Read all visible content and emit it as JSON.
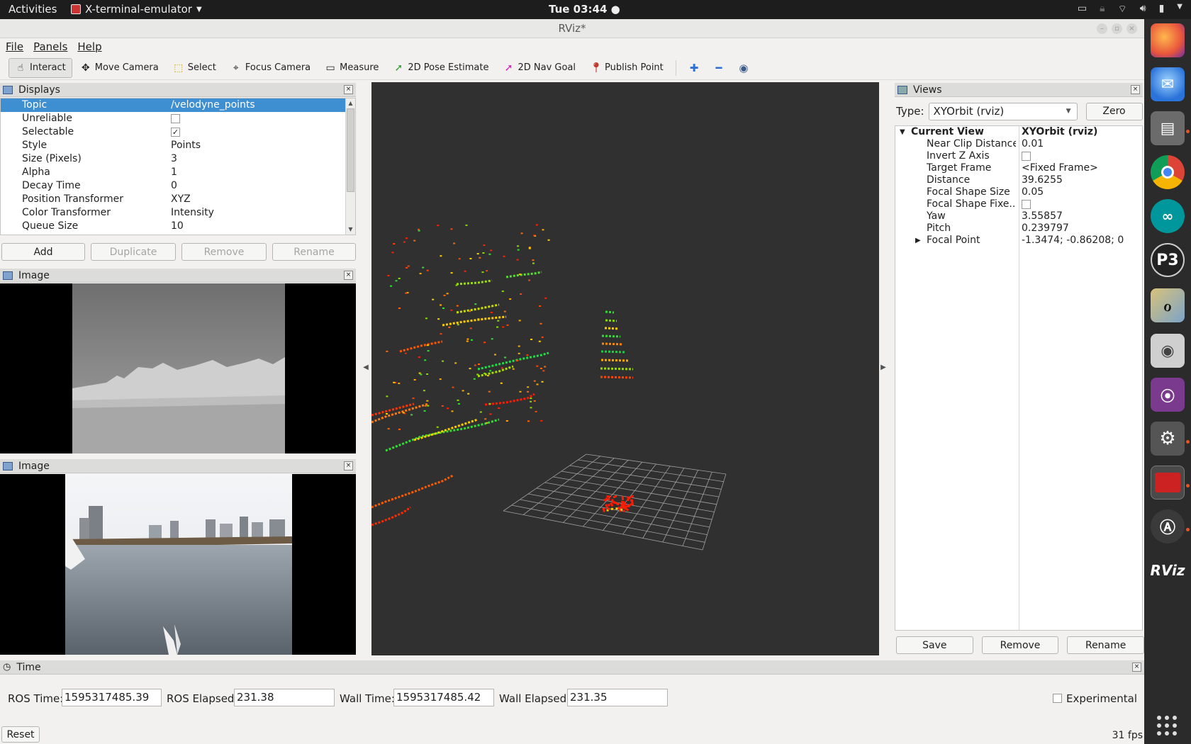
{
  "topbar": {
    "activities": "Activities",
    "app_name": "X-terminal-emulator",
    "clock": "Tue 03:44"
  },
  "window": {
    "title": "RViz*"
  },
  "menu": {
    "file": "File",
    "panels": "Panels",
    "help": "Help"
  },
  "toolbar": {
    "interact": "Interact",
    "move_camera": "Move Camera",
    "select": "Select",
    "focus_camera": "Focus Camera",
    "measure": "Measure",
    "pose_estimate": "2D Pose Estimate",
    "nav_goal": "2D Nav Goal",
    "publish_point": "Publish Point"
  },
  "displays": {
    "title": "Displays",
    "props": [
      {
        "key": "Topic",
        "value": "/velodyne_points"
      },
      {
        "key": "Unreliable",
        "checkbox": false
      },
      {
        "key": "Selectable",
        "checkbox": true
      },
      {
        "key": "Style",
        "value": "Points"
      },
      {
        "key": "Size (Pixels)",
        "value": "3"
      },
      {
        "key": "Alpha",
        "value": "1"
      },
      {
        "key": "Decay Time",
        "value": "0"
      },
      {
        "key": "Position Transformer",
        "value": "XYZ"
      },
      {
        "key": "Color Transformer",
        "value": "Intensity"
      },
      {
        "key": "Queue Size",
        "value": "10"
      }
    ],
    "buttons": {
      "add": "Add",
      "duplicate": "Duplicate",
      "remove": "Remove",
      "rename": "Rename"
    }
  },
  "image_panels": [
    {
      "title": "Image"
    },
    {
      "title": "Image"
    }
  ],
  "views": {
    "title": "Views",
    "type_label": "Type:",
    "type_value": "XYOrbit (rviz)",
    "zero": "Zero",
    "current_view": {
      "key": "Current View",
      "value": "XYOrbit (rviz)"
    },
    "props": [
      {
        "key": "Near Clip Distance",
        "value": "0.01"
      },
      {
        "key": "Invert Z Axis",
        "checkbox": false
      },
      {
        "key": "Target Frame",
        "value": "<Fixed Frame>"
      },
      {
        "key": "Distance",
        "value": "39.6255"
      },
      {
        "key": "Focal Shape Size",
        "value": "0.05"
      },
      {
        "key": "Focal Shape Fixe...",
        "checkbox": false
      },
      {
        "key": "Yaw",
        "value": "3.55857"
      },
      {
        "key": "Pitch",
        "value": "0.239797"
      },
      {
        "key": "Focal Point",
        "value": "-1.3474; -0.86208; 0",
        "expandable": true
      }
    ],
    "buttons": {
      "save": "Save",
      "remove": "Remove",
      "rename": "Rename"
    }
  },
  "time": {
    "title": "Time",
    "ros_time_label": "ROS Time:",
    "ros_time": "1595317485.39",
    "ros_elapsed_label": "ROS Elapsed:",
    "ros_elapsed": "231.38",
    "wall_time_label": "Wall Time:",
    "wall_time": "1595317485.42",
    "wall_elapsed_label": "Wall Elapsed:",
    "wall_elapsed": "231.35",
    "experimental": "Experimental",
    "reset": "Reset",
    "fps": "31 fps"
  },
  "dock": {
    "rviz_label": "RViz",
    "items": [
      "firefox-icon",
      "thunderbird-icon",
      "files-icon",
      "chrome-icon",
      "arduino-icon",
      "processing-icon",
      "qgis-icon",
      "camera-icon",
      "screen-recorder-icon",
      "settings-icon",
      "terminal-icon",
      "software-updater-icon",
      "rviz-icon"
    ]
  },
  "colors": {
    "selection": "#3d8fd1",
    "viewport_bg": "#303030",
    "dock_bg": "#2b2b2b",
    "topbar_bg": "#1d1d1d"
  }
}
